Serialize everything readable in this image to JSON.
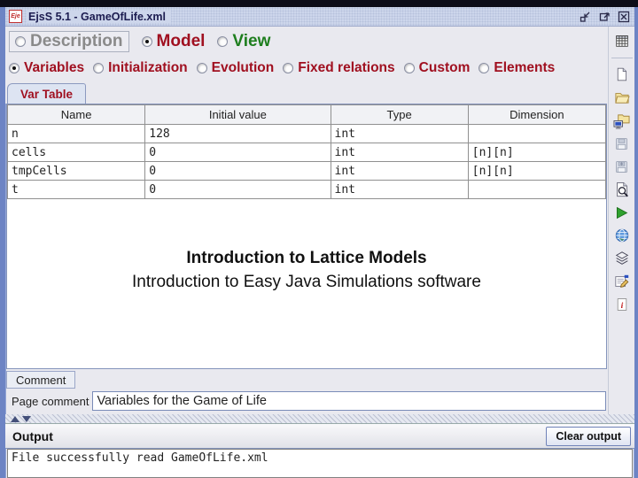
{
  "colors": {
    "frame_blue": "#6d84c4",
    "titlebar": "#cdd6eb",
    "maroon_accent": "#a01020",
    "green_accent": "#1e7e1e",
    "gray_unselected": "#8a8a8a",
    "run_green": "#2fa12f"
  },
  "window": {
    "icon_label": "Eje",
    "title": "EjsS 5.1 - GameOfLife.xml",
    "controls": [
      "iconify",
      "maximize",
      "close"
    ]
  },
  "nav": {
    "main": [
      {
        "label": "Description",
        "selected": false
      },
      {
        "label": "Model",
        "selected": true
      },
      {
        "label": "View",
        "selected": false
      }
    ],
    "model": [
      {
        "label": "Variables",
        "selected": true
      },
      {
        "label": "Initialization",
        "selected": false
      },
      {
        "label": "Evolution",
        "selected": false
      },
      {
        "label": "Fixed relations",
        "selected": false
      },
      {
        "label": "Custom",
        "selected": false
      },
      {
        "label": "Elements",
        "selected": false
      }
    ]
  },
  "workpanel": {
    "tab_label": "Var Table"
  },
  "variables_table": {
    "columns": [
      "Name",
      "Initial value",
      "Type",
      "Dimension"
    ],
    "rows": [
      [
        "n",
        "128",
        "int",
        ""
      ],
      [
        "cells",
        "0",
        "int",
        "[n][n]"
      ],
      [
        "tmpCells",
        "0",
        "int",
        "[n][n]"
      ],
      [
        "t",
        "0",
        "int",
        ""
      ]
    ]
  },
  "slide_text": {
    "title": "Introduction to Lattice Models",
    "subtitle": "Introduction to Easy Java Simulations software"
  },
  "comment_panel": {
    "comment_label": "Comment",
    "page_comment_label": "Page comment",
    "page_comment_value": "Variables for the Game of Life"
  },
  "output_panel": {
    "title": "Output",
    "clear_button_label": "Clear output",
    "console_text": "File successfully read GameOfLife.xml"
  },
  "toolbar": {
    "icons": [
      "table-grid",
      "new-file",
      "open-file",
      "import-library",
      "save",
      "save-as",
      "search-preview",
      "run-simulation",
      "package-globe",
      "digital-library",
      "options",
      "info-help"
    ]
  }
}
